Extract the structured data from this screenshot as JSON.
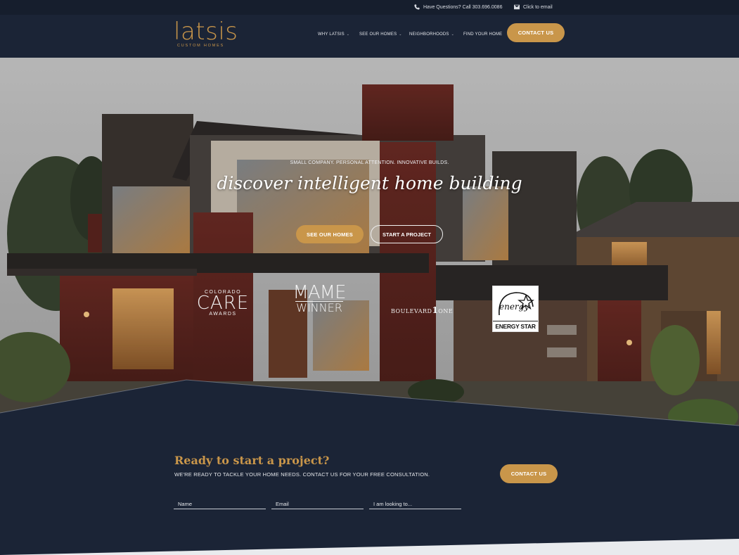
{
  "topbar": {
    "phone_text": "Have Questions? Call 303.696.0086",
    "email_text": "Click to email",
    "phone_icon": "phone-icon",
    "email_icon": "envelope-icon"
  },
  "header": {
    "logo_name": "latsis",
    "logo_tagline": "CUSTOM HOMES",
    "nav": [
      {
        "label": "WHY LATSIS",
        "has_dropdown": true
      },
      {
        "label": "SEE OUR HOMES",
        "has_dropdown": true
      },
      {
        "label": "NEIGHBORHOODS",
        "has_dropdown": true
      },
      {
        "label": "FIND YOUR HOME",
        "has_dropdown": false
      }
    ],
    "caret": "⌄",
    "contact_label": "CONTACT US"
  },
  "hero": {
    "kicker": "SMALL COMPANY. PERSONAL ATTENTION. INNOVATIVE BUILDS.",
    "headline": "discover intelligent home building",
    "primary_button": "SEE OUR HOMES",
    "secondary_button": "START A PROJECT"
  },
  "awards": {
    "care_top": "COLORADO",
    "care_main": "CARE",
    "care_bottom": "AWARDS",
    "mame_main": "MAME",
    "mame_sub": "WINNER",
    "blvd_left": "BOULEVARD",
    "blvd_num": "1",
    "blvd_right": "ONE",
    "energy_script": "energy",
    "energy_label": "ENERGY STAR"
  },
  "cta": {
    "title": "Ready to start a project?",
    "subtitle": "WE'RE READY TO TACKLE YOUR HOME NEEDS. CONTACT US FOR YOUR FREE CONSULTATION.",
    "button": "CONTACT US",
    "fields": {
      "name_placeholder": "Name",
      "email_placeholder": "Email",
      "looking_placeholder": "I am looking to..."
    }
  },
  "colors": {
    "navy": "#1b2436",
    "gold": "#c9964a",
    "brick": "#7a3128"
  }
}
